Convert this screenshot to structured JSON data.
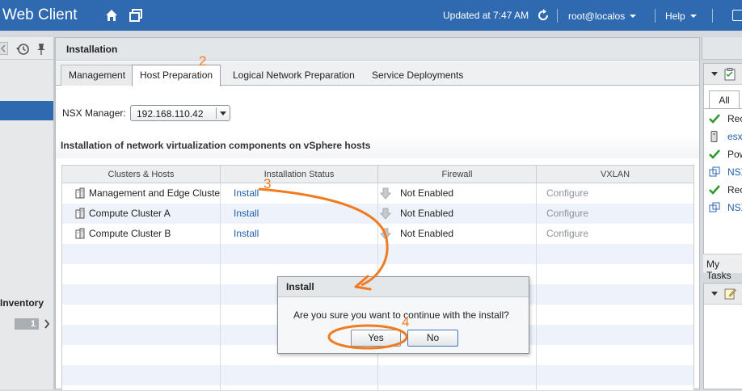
{
  "topbar": {
    "app_title": "Web Client",
    "updated": "Updated at 7:47 AM",
    "user": "root@localos",
    "help": "Help"
  },
  "left_nav": {
    "inventory_label": "Inventory",
    "inventory_count": "1"
  },
  "main": {
    "title": "Installation",
    "tabs": [
      {
        "label": "Management"
      },
      {
        "label": "Host Preparation"
      },
      {
        "label": "Logical Network Preparation"
      },
      {
        "label": "Service Deployments"
      }
    ],
    "nsx_manager_label": "NSX Manager:",
    "nsx_manager_value": "192.168.110.42",
    "section_title": "Installation of network virtualization components on vSphere hosts",
    "grid": {
      "columns": [
        "Clusters & Hosts",
        "Installation Status",
        "Firewall",
        "VXLAN"
      ],
      "rows": [
        {
          "name": "Management and Edge Cluste",
          "status": "Install",
          "firewall": "Not Enabled",
          "vxlan": "Configure"
        },
        {
          "name": "Compute Cluster A",
          "status": "Install",
          "firewall": "Not Enabled",
          "vxlan": "Configure"
        },
        {
          "name": "Compute Cluster B",
          "status": "Install",
          "firewall": "Not Enabled",
          "vxlan": "Configure"
        }
      ]
    }
  },
  "right_panel": {
    "tab_all": "All",
    "items": [
      {
        "icon": "check-icon",
        "text": "Rec"
      },
      {
        "icon": "host-icon",
        "text": "esx"
      },
      {
        "icon": "check-icon",
        "text": "Pow"
      },
      {
        "icon": "nsx-icon",
        "text": "NSX"
      },
      {
        "icon": "check-icon",
        "text": "Rec"
      },
      {
        "icon": "nsx-icon",
        "text": "NSX"
      }
    ],
    "my_tasks": "My Tasks"
  },
  "dialog": {
    "title": "Install",
    "message": "Are you sure you want to continue with the install?",
    "yes": "Yes",
    "no": "No"
  },
  "annotations": {
    "step2": "2",
    "step3": "3",
    "step4": "4",
    "color": "#f07b22"
  },
  "colors": {
    "topbar": "#2f6ab0",
    "link": "#1f5ea8",
    "row_alt": "#edf2fb"
  }
}
